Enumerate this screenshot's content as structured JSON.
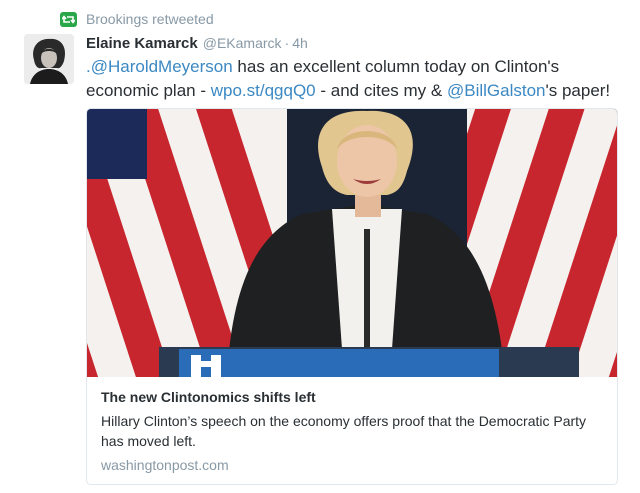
{
  "retweet": {
    "label": "Brookings retweeted",
    "icon": "retweet-icon"
  },
  "author": {
    "name": "Elaine Kamarck",
    "handle": "@EKamarck",
    "separator": "·",
    "time": "4h"
  },
  "tweet": {
    "mention1": ".@HaroldMeyerson",
    "text1": " has an excellent column today on Clinton's economic plan - ",
    "link": "wpo.st/qgqQ0",
    "text2": " - and cites my & ",
    "mention2": "@BillGalston",
    "text3": "'s paper!"
  },
  "card": {
    "title": "The new Clintonomics shifts left",
    "description": "Hillary Clinton’s speech on the economy offers proof that the Democratic Party has moved left.",
    "domain": "washingtonpost.com"
  },
  "colors": {
    "link": "#3b88c3",
    "retweet_green": "#2aa74a",
    "muted": "#8899a6"
  }
}
